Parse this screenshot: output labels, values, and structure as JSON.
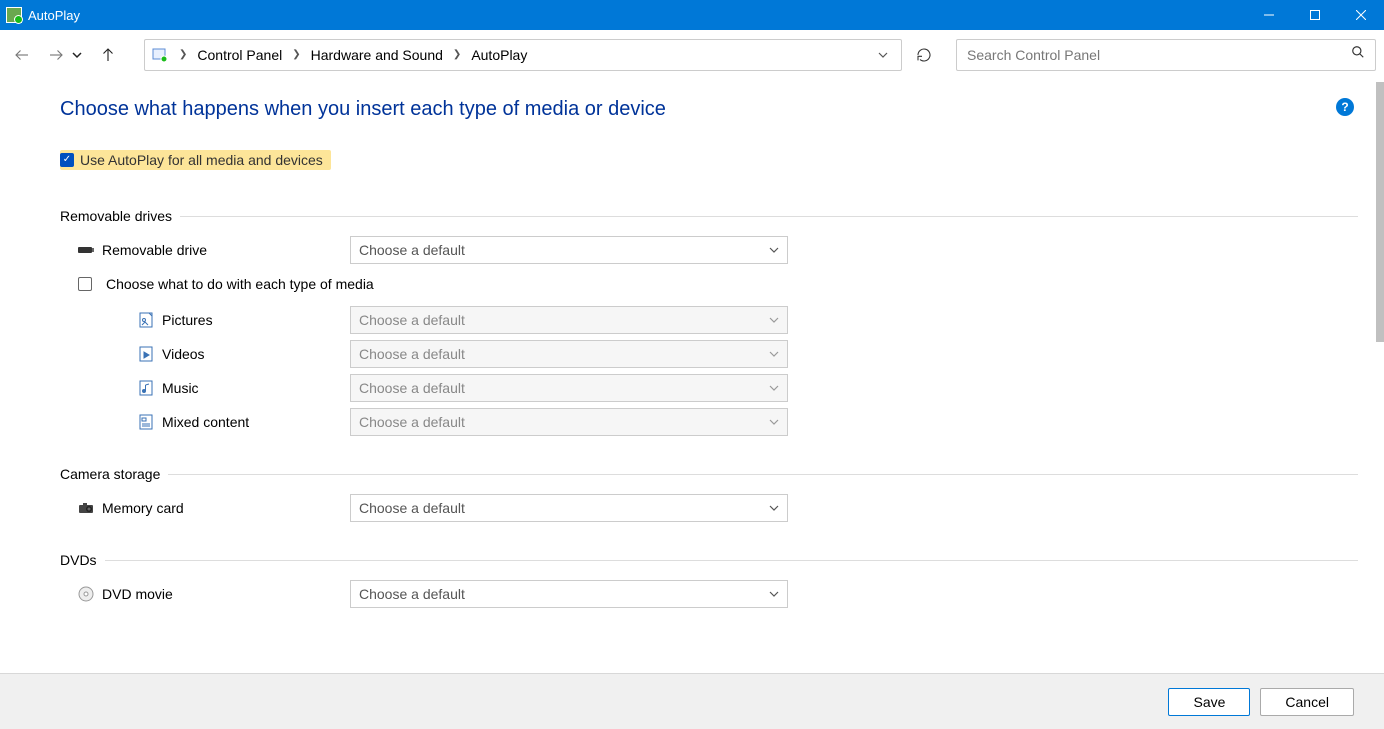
{
  "titlebar": {
    "title": "AutoPlay"
  },
  "breadcrumb": {
    "items": [
      "Control Panel",
      "Hardware and Sound",
      "AutoPlay"
    ]
  },
  "search": {
    "placeholder": "Search Control Panel"
  },
  "page": {
    "title": "Choose what happens when you insert each type of media or device",
    "use_autoplay_label": "Use AutoPlay for all media and devices",
    "sub_media_label": "Choose what to do with each type of media",
    "default_option": "Choose a default"
  },
  "sections": {
    "removable": {
      "title": "Removable drives",
      "items": {
        "removable_drive": "Removable drive",
        "pictures": "Pictures",
        "videos": "Videos",
        "music": "Music",
        "mixed": "Mixed content"
      }
    },
    "camera": {
      "title": "Camera storage",
      "items": {
        "memory_card": "Memory card"
      }
    },
    "dvds": {
      "title": "DVDs",
      "items": {
        "dvd_movie": "DVD movie"
      }
    }
  },
  "footer": {
    "save": "Save",
    "cancel": "Cancel"
  }
}
